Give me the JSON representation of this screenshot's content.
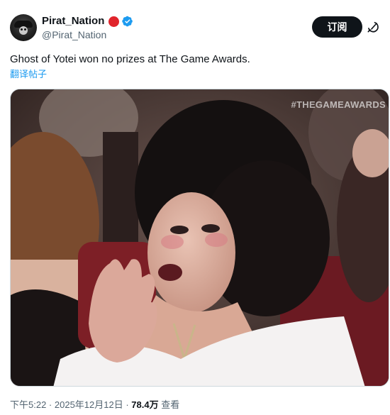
{
  "author": {
    "display_name": "Pirat_Nation",
    "handle": "@Pirat_Nation",
    "avatar": "pirate-avatar"
  },
  "actions": {
    "subscribe_label": "订阅",
    "grok_icon": "grok-icon"
  },
  "tweet": {
    "text": "Ghost of Yotei won no prizes at The Game Awards.",
    "translate_label": "翻译帖子"
  },
  "media": {
    "watermark": "#THEGAMEAWARDS"
  },
  "meta": {
    "time": "下午5:22",
    "separator_1": " · ",
    "date": "2025年12月12日",
    "separator_2": " · ",
    "views": "78.4万",
    "views_label": " 查看"
  },
  "colors": {
    "link": "#1d9bf0",
    "verified": "#1d9bf0",
    "badge_red": "#e0242b",
    "subscribe_bg": "#0f1419"
  }
}
